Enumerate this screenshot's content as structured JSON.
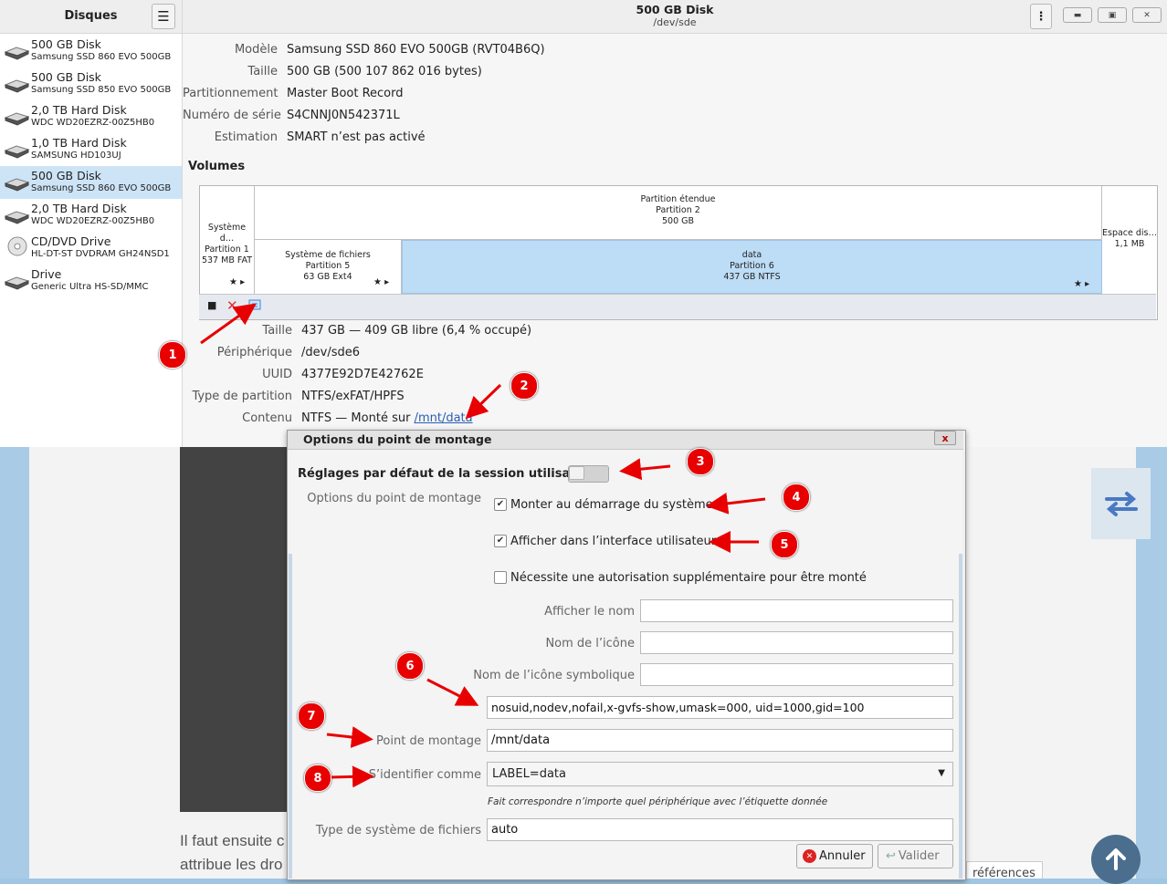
{
  "sidebar": {
    "title": "Disques",
    "menu_icon": "hamburger-icon",
    "items": [
      {
        "name": "500 GB Disk",
        "model": "Samsung SSD 860 EVO 500GB",
        "icon": "hard-disk-icon",
        "selected": false
      },
      {
        "name": "500 GB Disk",
        "model": "Samsung SSD 850 EVO 500GB",
        "icon": "hard-disk-icon",
        "selected": false
      },
      {
        "name": "2,0 TB Hard Disk",
        "model": "WDC WD20EZRZ-00Z5HB0",
        "icon": "hard-disk-icon",
        "selected": false
      },
      {
        "name": "1,0 TB Hard Disk",
        "model": "SAMSUNG HD103UJ",
        "icon": "hard-disk-icon",
        "selected": false
      },
      {
        "name": "500 GB Disk",
        "model": "Samsung SSD 860 EVO 500GB",
        "icon": "hard-disk-icon",
        "selected": true
      },
      {
        "name": "2,0 TB Hard Disk",
        "model": "WDC WD20EZRZ-00Z5HB0",
        "icon": "hard-disk-icon",
        "selected": false
      },
      {
        "name": "CD/DVD Drive",
        "model": "HL-DT-ST DVDRAM GH24NSD1",
        "icon": "optical-disc-icon",
        "selected": false
      },
      {
        "name": "Drive",
        "model": "Generic Ultra HS-SD/MMC",
        "icon": "hard-disk-icon",
        "selected": false
      }
    ]
  },
  "window": {
    "title": "500 GB Disk",
    "subtitle": "/dev/sde"
  },
  "disk_props": [
    {
      "label": "Modèle",
      "value": "Samsung SSD 860 EVO 500GB (RVT04B6Q)"
    },
    {
      "label": "Taille",
      "value": "500 GB (500 107 862 016 bytes)"
    },
    {
      "label": "Partitionnement",
      "value": "Master Boot Record"
    },
    {
      "label": "Numéro de série",
      "value": "S4CNNJ0N542371L"
    },
    {
      "label": "Estimation",
      "value": "SMART n’est pas activé"
    }
  ],
  "volumes": {
    "heading": "Volumes",
    "p1": {
      "line1": "Système d…",
      "line2": "Partition 1",
      "line3": "537 MB FAT"
    },
    "extended": {
      "line1": "Partition étendue",
      "line2": "Partition 2",
      "line3": "500 GB"
    },
    "p5": {
      "line1": "Système de fichiers",
      "line2": "Partition 5",
      "line3": "63 GB Ext4"
    },
    "p6": {
      "line1": "data",
      "line2": "Partition 6",
      "line3": "437 GB NTFS"
    },
    "free": {
      "line1": "Espace dis…",
      "line2": "1,1 MB"
    }
  },
  "partition_props": [
    {
      "label": "Taille",
      "value": "437 GB — 409 GB libre (6,4 % occupé)"
    },
    {
      "label": "Périphérique",
      "value": "/dev/sde6"
    },
    {
      "label": "UUID",
      "value": "4377E92D7E42762E"
    },
    {
      "label": "Type de partition",
      "value": "NTFS/exFAT/HPFS"
    },
    {
      "label": "Contenu",
      "value": "NTFS — Monté sur ",
      "link": "/mnt/data"
    }
  ],
  "annotations": [
    "1",
    "2",
    "3",
    "4",
    "5",
    "6",
    "7",
    "8"
  ],
  "dialog": {
    "title": "Options du point de montage",
    "close_label": "x",
    "session_defaults_label": "Réglages par défaut de la session utilisateur",
    "session_defaults_on": false,
    "mount_options_label": "Options du point de montage",
    "mount_at_startup_label": "Monter au démarrage du système",
    "mount_at_startup_checked": true,
    "show_in_ui_label": "Afficher dans l’interface utilisateur",
    "show_in_ui_checked": true,
    "require_auth_label": "Nécessite une autorisation supplémentaire pour être monté",
    "require_auth_checked": false,
    "display_name_label": "Afficher le nom",
    "display_name_value": "",
    "icon_name_label": "Nom de l’icône",
    "icon_name_value": "",
    "symbolic_icon_label": "Nom de l’icône symbolique",
    "symbolic_icon_value": "",
    "options_value": "nosuid,nodev,nofail,x-gvfs-show,umask=000, uid=1000,gid=100",
    "mount_point_label": "Point de montage",
    "mount_point_value": "/mnt/data",
    "identify_as_label": "S’identifier comme",
    "identify_as_value": "LABEL=data",
    "identify_hint": "Fait correspondre n’importe quel périphérique avec l’étiquette donnée",
    "fs_type_label": "Type de système de fichiers",
    "fs_type_value": "auto",
    "cancel_label": "Annuler",
    "ok_label": "Valider"
  },
  "website": {
    "text_line1": "Il faut ensuite c",
    "text_line2": "attribue les dro",
    "ref_text": "références"
  },
  "colors": {
    "selection": "#cde4f7",
    "partition_selected": "#bddcf6",
    "annotation_red": "#e80000",
    "link": "#2a5db0"
  }
}
